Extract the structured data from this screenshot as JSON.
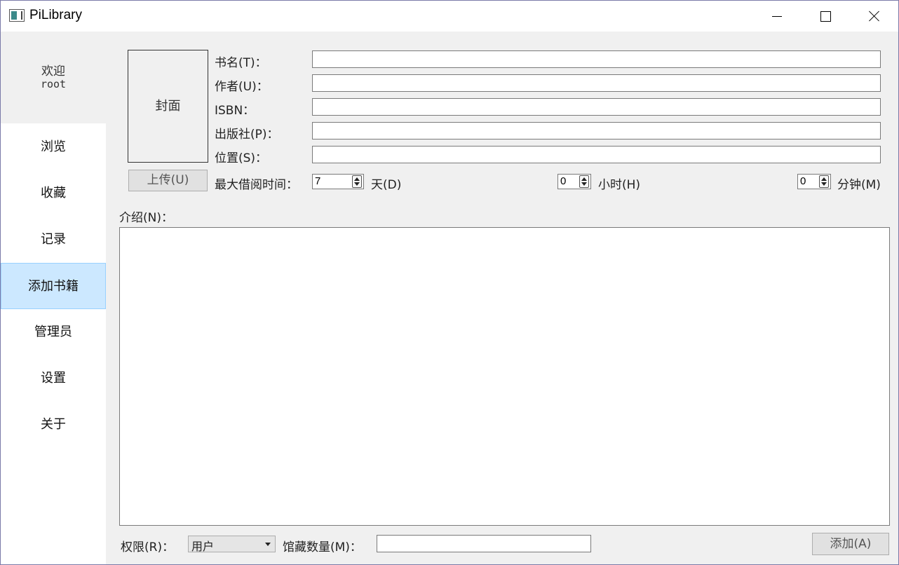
{
  "window": {
    "title": "PiLibrary"
  },
  "sidebar": {
    "welcome_label": "欢迎",
    "username": "root",
    "items": [
      {
        "label": "浏览"
      },
      {
        "label": "收藏"
      },
      {
        "label": "记录"
      },
      {
        "label": "添加书籍",
        "active": true
      },
      {
        "label": "管理员"
      },
      {
        "label": "设置"
      },
      {
        "label": "关于"
      }
    ]
  },
  "form": {
    "cover_label": "封面",
    "upload_label": "上传(U)",
    "fields": [
      {
        "label": "书名(T)：",
        "value": ""
      },
      {
        "label": "作者(U)：",
        "value": ""
      },
      {
        "label": "ISBN：",
        "value": ""
      },
      {
        "label": "出版社(P)：",
        "value": ""
      },
      {
        "label": "位置(S)：",
        "value": ""
      }
    ],
    "max_borrow_label": "最大借阅时间：",
    "days": {
      "value": "7",
      "unit": "天(D)"
    },
    "hours": {
      "value": "0",
      "unit": "小时(H)"
    },
    "minutes": {
      "value": "0",
      "unit": "分钟(M)"
    },
    "intro_label": "介绍(N)：",
    "intro_value": "",
    "permission_label": "权限(R)：",
    "permission_value": "用户",
    "quantity_label": "馆藏数量(M)：",
    "quantity_value": "",
    "add_label": "添加(A)"
  },
  "colors": {
    "nav_active_bg": "#cce8ff",
    "nav_active_border": "#99d1ff",
    "window_bg": "#f0f0f0"
  }
}
